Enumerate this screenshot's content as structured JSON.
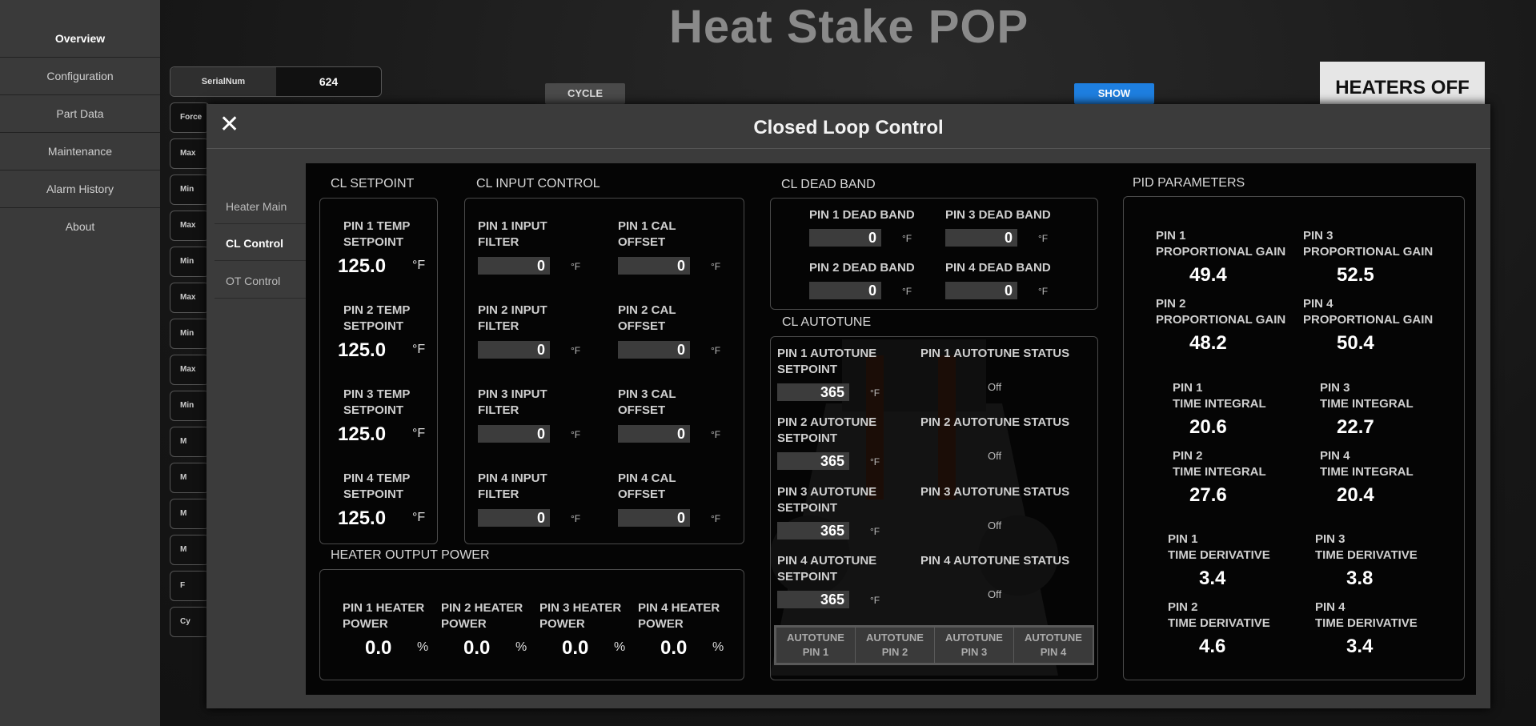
{
  "app": {
    "title": "Heat Stake POP"
  },
  "sidebar": {
    "items": [
      {
        "label": "Overview"
      },
      {
        "label": "Configuration"
      },
      {
        "label": "Part Data"
      },
      {
        "label": "Maintenance"
      },
      {
        "label": "Alarm History"
      },
      {
        "label": "About"
      }
    ]
  },
  "background": {
    "serial_label": "SerialNum",
    "serial_value": "624",
    "row_labels": [
      "Force",
      "Max",
      "Min",
      "Max",
      "Min",
      "Max",
      "Min",
      "Max",
      "Min",
      "M",
      "M",
      "M",
      "M",
      "F",
      "Cy"
    ],
    "cycle": "CYCLE",
    "show": "SHOW",
    "heaters": "HEATERS OFF"
  },
  "modal": {
    "title": "Closed Loop Control",
    "close": "✕",
    "tabs": [
      {
        "label": "Heater Main"
      },
      {
        "label": "CL Control"
      },
      {
        "label": "OT Control"
      }
    ]
  },
  "setpoint": {
    "title": "CL SETPOINT",
    "unit": "°F",
    "pins": [
      {
        "l1": "PIN 1 TEMP",
        "l2": "SETPOINT",
        "value": "125.0"
      },
      {
        "l1": "PIN 2 TEMP",
        "l2": "SETPOINT",
        "value": "125.0"
      },
      {
        "l1": "PIN 3 TEMP",
        "l2": "SETPOINT",
        "value": "125.0"
      },
      {
        "l1": "PIN 4 TEMP",
        "l2": "SETPOINT",
        "value": "125.0"
      }
    ]
  },
  "input_control": {
    "title": "CL INPUT CONTROL",
    "unit": "°F",
    "rows": [
      {
        "f1": "PIN 1 INPUT",
        "f2": "FILTER",
        "fv": "0",
        "c1": "PIN 1 CAL",
        "c2": "OFFSET",
        "cv": "0"
      },
      {
        "f1": "PIN 2 INPUT",
        "f2": "FILTER",
        "fv": "0",
        "c1": "PIN 2 CAL",
        "c2": "OFFSET",
        "cv": "0"
      },
      {
        "f1": "PIN 3 INPUT",
        "f2": "FILTER",
        "fv": "0",
        "c1": "PIN 3 CAL",
        "c2": "OFFSET",
        "cv": "0"
      },
      {
        "f1": "PIN 4 INPUT",
        "f2": "FILTER",
        "fv": "0",
        "c1": "PIN 4 CAL",
        "c2": "OFFSET",
        "cv": "0"
      }
    ]
  },
  "output_power": {
    "title": "HEATER OUTPUT POWER",
    "unit": "%",
    "pins": [
      {
        "l1": "PIN 1 HEATER",
        "l2": "POWER",
        "value": "0.0"
      },
      {
        "l1": "PIN 2 HEATER",
        "l2": "POWER",
        "value": "0.0"
      },
      {
        "l1": "PIN 3 HEATER",
        "l2": "POWER",
        "value": "0.0"
      },
      {
        "l1": "PIN 4 HEATER",
        "l2": "POWER",
        "value": "0.0"
      }
    ]
  },
  "dead_band": {
    "title": "CL DEAD BAND",
    "unit": "°F",
    "pins": [
      {
        "label": "PIN 1 DEAD BAND",
        "value": "0"
      },
      {
        "label": "PIN 3 DEAD BAND",
        "value": "0"
      },
      {
        "label": "PIN 2 DEAD BAND",
        "value": "0"
      },
      {
        "label": "PIN 4 DEAD BAND",
        "value": "0"
      }
    ]
  },
  "autotune": {
    "title": "CL AUTOTUNE",
    "unit": "°F",
    "rows": [
      {
        "l1": "PIN 1 AUTOTUNE",
        "l2": "SETPOINT",
        "value": "365",
        "status_label": "PIN 1 AUTOTUNE STATUS",
        "status": "Off"
      },
      {
        "l1": "PIN 2 AUTOTUNE",
        "l2": "SETPOINT",
        "value": "365",
        "status_label": "PIN 2 AUTOTUNE STATUS",
        "status": "Off"
      },
      {
        "l1": "PIN 3 AUTOTUNE",
        "l2": "SETPOINT",
        "value": "365",
        "status_label": "PIN 3 AUTOTUNE STATUS",
        "status": "Off"
      },
      {
        "l1": "PIN 4 AUTOTUNE",
        "l2": "SETPOINT",
        "value": "365",
        "status_label": "PIN 4 AUTOTUNE STATUS",
        "status": "Off"
      }
    ],
    "buttons": [
      {
        "l1": "AUTOTUNE",
        "l2": "PIN 1"
      },
      {
        "l1": "AUTOTUNE",
        "l2": "PIN 2"
      },
      {
        "l1": "AUTOTUNE",
        "l2": "PIN 3"
      },
      {
        "l1": "AUTOTUNE",
        "l2": "PIN 4"
      }
    ]
  },
  "pid": {
    "title": "PID PARAMETERS",
    "items": [
      {
        "l1": "PIN 1",
        "l2": "PROPORTIONAL GAIN",
        "value": "49.4"
      },
      {
        "l1": "PIN 3",
        "l2": "PROPORTIONAL GAIN",
        "value": "52.5"
      },
      {
        "l1": "PIN 2",
        "l2": "PROPORTIONAL GAIN",
        "value": "48.2"
      },
      {
        "l1": "PIN 4",
        "l2": "PROPORTIONAL GAIN",
        "value": "50.4"
      },
      {
        "l1": "PIN 1",
        "l2": "TIME INTEGRAL",
        "value": "20.6"
      },
      {
        "l1": "PIN 3",
        "l2": "TIME INTEGRAL",
        "value": "22.7"
      },
      {
        "l1": "PIN 2",
        "l2": "TIME INTEGRAL",
        "value": "27.6"
      },
      {
        "l1": "PIN 4",
        "l2": "TIME INTEGRAL",
        "value": "20.4"
      },
      {
        "l1": "PIN 1",
        "l2": "TIME DERIVATIVE",
        "value": "3.4"
      },
      {
        "l1": "PIN 3",
        "l2": "TIME DERIVATIVE",
        "value": "3.8"
      },
      {
        "l1": "PIN 2",
        "l2": "TIME DERIVATIVE",
        "value": "4.6"
      },
      {
        "l1": "PIN 4",
        "l2": "TIME DERIVATIVE",
        "value": "3.4"
      }
    ]
  }
}
